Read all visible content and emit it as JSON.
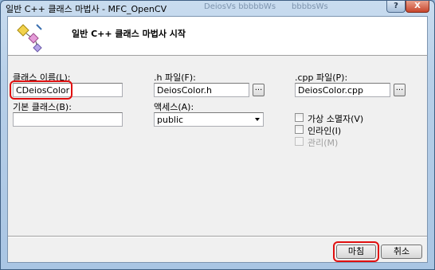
{
  "window": {
    "title": "일반 C++ 클래스 마법사 - MFC_OpenCV",
    "help_label": "?",
    "close_label": "X",
    "background_ghost_text_1": "DeiosVs bbbbbWs",
    "background_ghost_text_2": "bbbbsWs"
  },
  "header": {
    "title": "일반 C++ 클래스 마법사 시작",
    "icon": "class-wizard-icon"
  },
  "form": {
    "class_name_label": "클래스 이름(L):",
    "class_name_value": "CDeiosColor",
    "base_class_label": "기본 클래스(B):",
    "base_class_value": "",
    "h_file_label": ".h 파일(F):",
    "h_file_value": "DeiosColor.h",
    "access_label": "액세스(A):",
    "access_value": "public",
    "cpp_file_label": ".cpp 파일(P):",
    "cpp_file_value": "DeiosColor.cpp",
    "browse_label": "...",
    "virtual_destructor_label": "가상 소멸자(V)",
    "inline_label": "인라인(I)",
    "managed_label": "관리(M)"
  },
  "buttons": {
    "finish_label": "마침",
    "cancel_label": "취소"
  },
  "colors": {
    "highlight": "#e01010",
    "frame": "#b7cfe8"
  }
}
